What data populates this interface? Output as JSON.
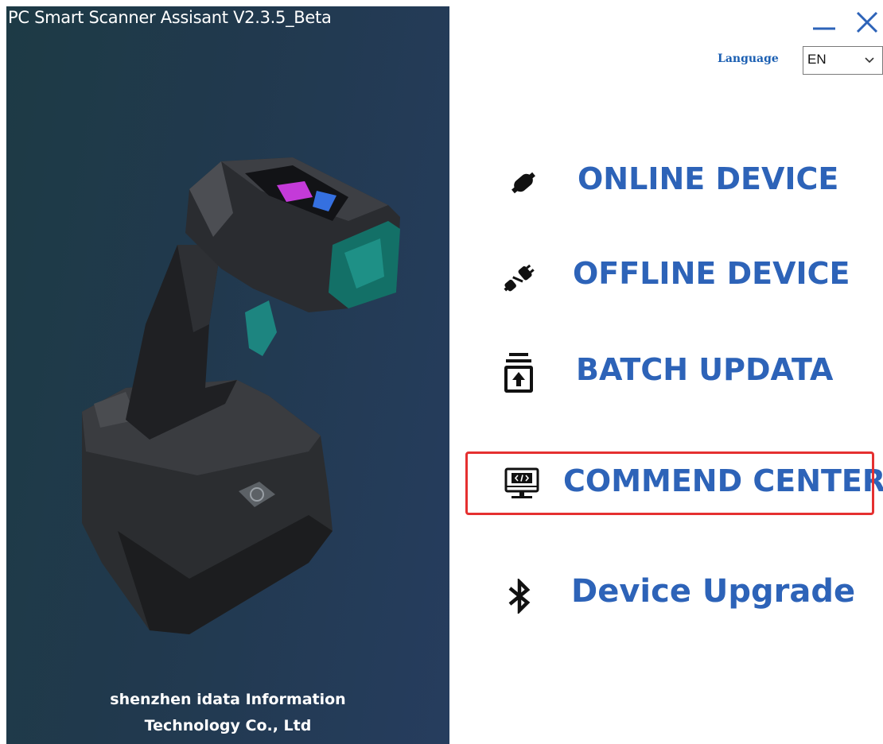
{
  "window": {
    "title": "PC Smart Scanner Assisant V2.3.5_Beta",
    "minimize_icon": "minimize-icon",
    "close_icon": "close-icon"
  },
  "language": {
    "label": "Language",
    "selected": "EN",
    "arrow_icon": "chevron-down-icon"
  },
  "menu": [
    {
      "label": "ONLINE DEVICE",
      "icon": "plug-connected-icon"
    },
    {
      "label": "OFFLINE DEVICE",
      "icon": "plug-disconnected-icon"
    },
    {
      "label": "BATCH UPDATA",
      "icon": "batch-upload-icon"
    },
    {
      "label": "COMMEND CENTER",
      "icon": "code-monitor-icon",
      "highlighted": true
    },
    {
      "label": "Device Upgrade",
      "icon": "bluetooth-icon"
    }
  ],
  "company": {
    "line1": "shenzhen idata Information",
    "line2": "Technology Co., Ltd"
  },
  "colors": {
    "accent": "#2d63b8",
    "highlight": "#e53030",
    "panel_bg": "#22394f"
  }
}
